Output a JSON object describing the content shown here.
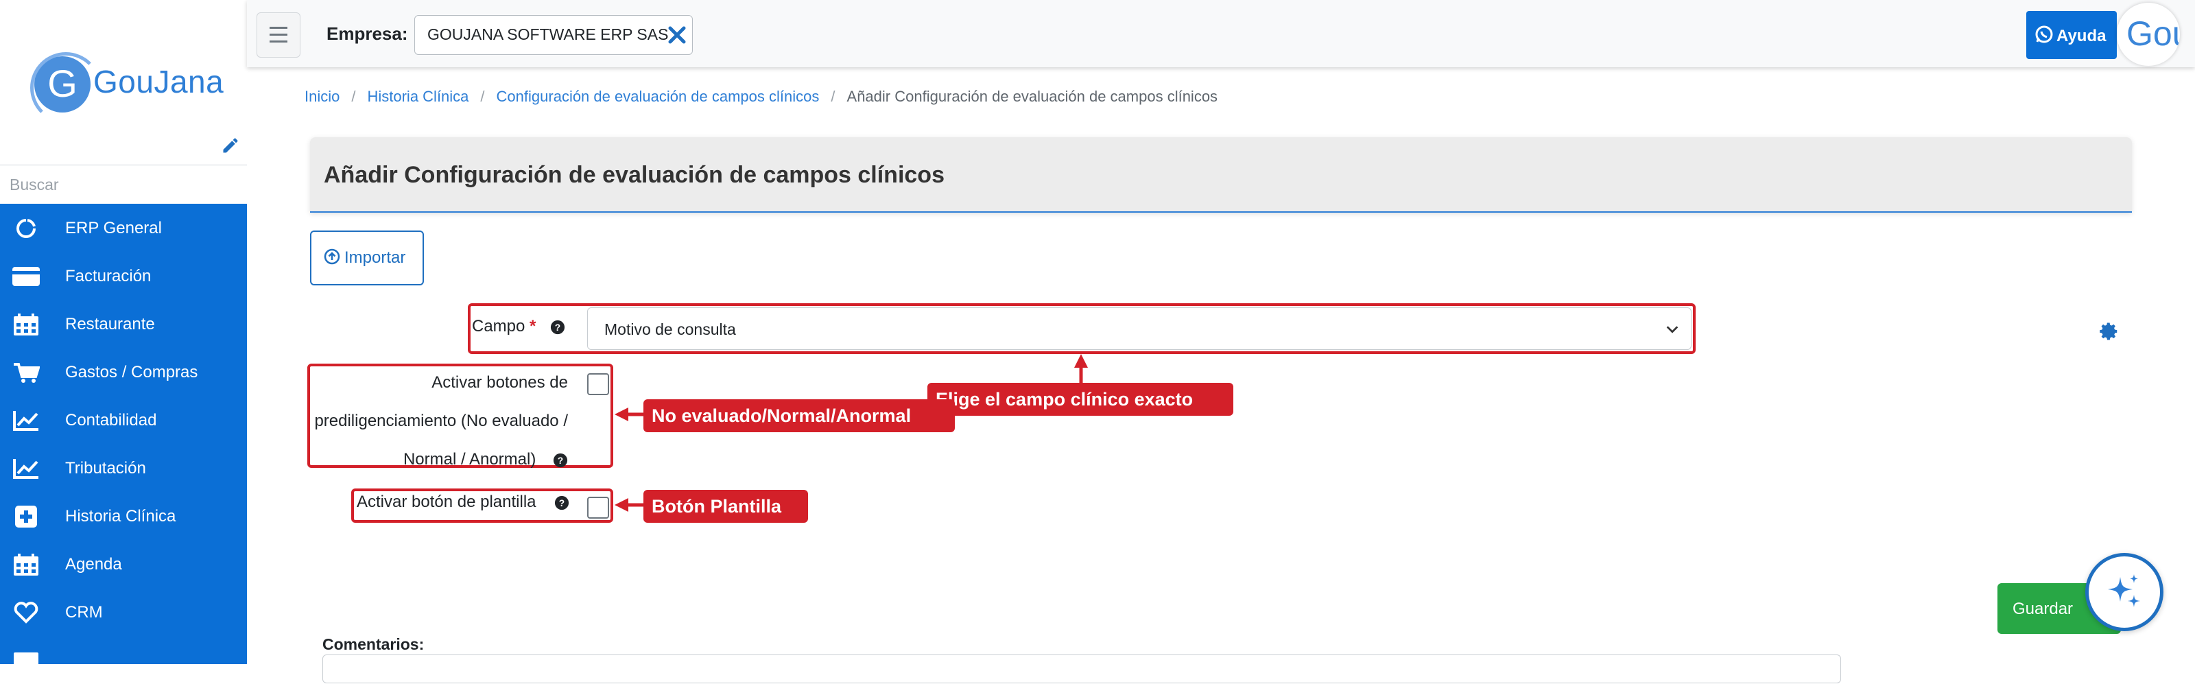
{
  "brand": {
    "logo_letter": "G",
    "logo_text": "GouJana"
  },
  "sidebar": {
    "search_placeholder": "Buscar",
    "items": [
      {
        "label": "ERP General",
        "icon": "circle-notch-icon"
      },
      {
        "label": "Facturación",
        "icon": "credit-card-icon"
      },
      {
        "label": "Restaurante",
        "icon": "calendar-icon"
      },
      {
        "label": "Gastos / Compras",
        "icon": "cart-icon"
      },
      {
        "label": "Contabilidad",
        "icon": "chart-line-icon"
      },
      {
        "label": "Tributación",
        "icon": "chart-line-icon"
      },
      {
        "label": "Historia Clínica",
        "icon": "plus-square-icon"
      },
      {
        "label": "Agenda",
        "icon": "calendar-icon"
      },
      {
        "label": "CRM",
        "icon": "heart-icon"
      }
    ]
  },
  "topbar": {
    "empresa_label": "Empresa:",
    "empresa_value": "GOUJANA SOFTWARE ERP SAS",
    "help_label": "Ayuda",
    "avatar_text": "Gou"
  },
  "breadcrumb": {
    "items": [
      "Inicio",
      "Historia Clínica",
      "Configuración de evaluación de campos clínicos"
    ],
    "current": "Añadir Configuración de evaluación de campos clínicos"
  },
  "page": {
    "title": "Añadir Configuración de evaluación de campos clínicos",
    "import_label": "Importar"
  },
  "form": {
    "campo_label": "Campo",
    "required_mark": "*",
    "campo_value": "Motivo de consulta",
    "prediligenciamiento_label": "Activar botones de prediligenciamiento (No evaluado / Normal / Anormal)",
    "prediligenciamiento_checked": false,
    "plantilla_label": "Activar botón de plantilla",
    "plantilla_checked": false,
    "comentarios_label": "Comentarios:",
    "save_label": "Guardar"
  },
  "annotations": {
    "campo_hint": "Elige el campo clínico exacto",
    "pred_hint": "No evaluado/Normal/Anormal",
    "plantilla_hint": "Botón Plantilla"
  },
  "colors": {
    "sidebar_bg": "#0b6fd6",
    "accent": "#2f7fd6",
    "annotation": "#d32029",
    "save": "#28a745"
  }
}
